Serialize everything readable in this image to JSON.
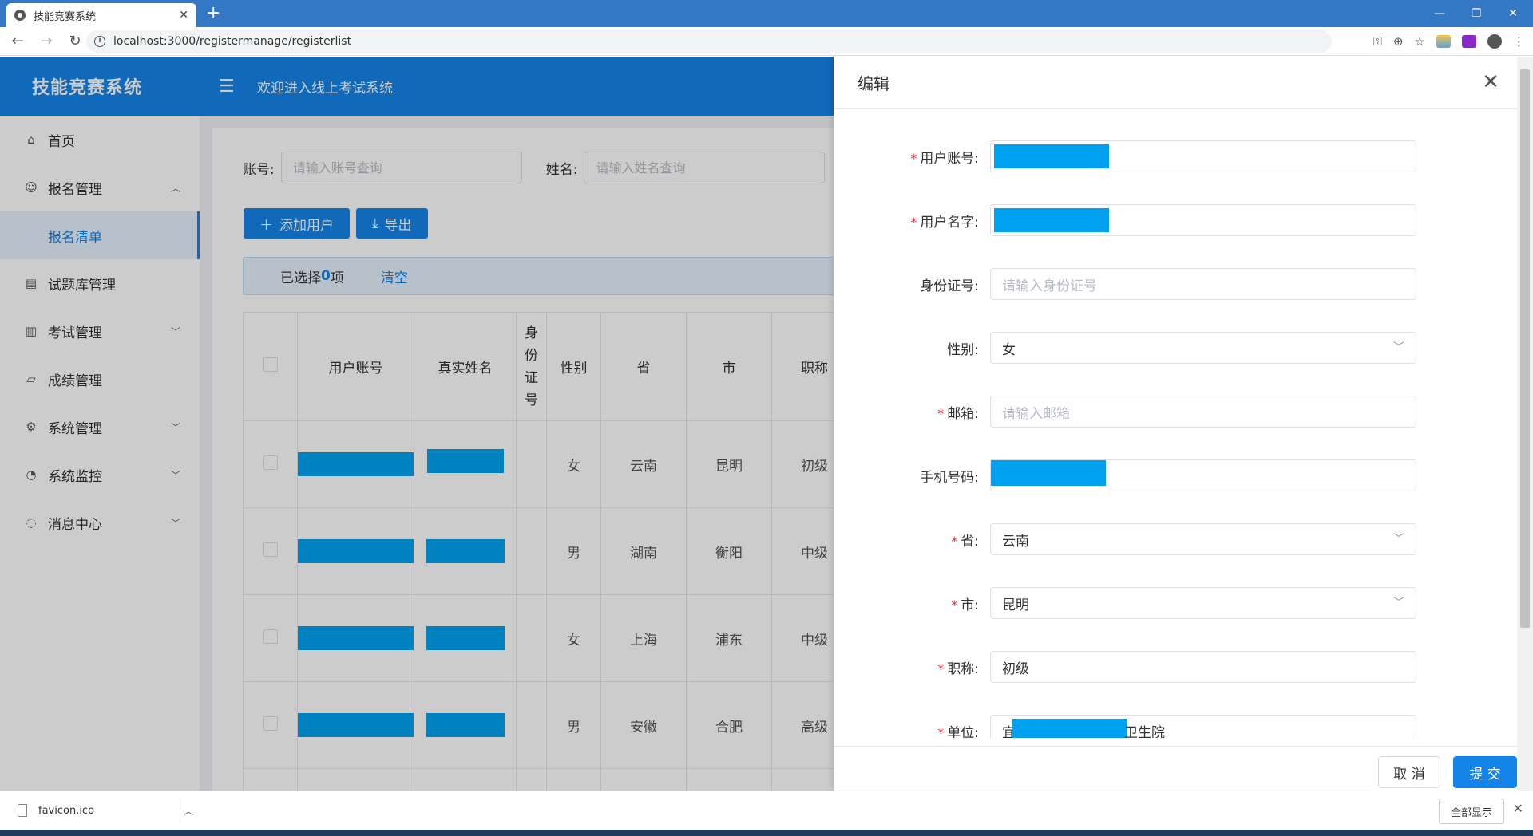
{
  "browser": {
    "tab_title": "技能竞赛系统",
    "url": "localhost:3000/registermanage/registerlist"
  },
  "app": {
    "brand": "技能竞赛系统",
    "welcome": "欢迎进入线上考试系统"
  },
  "sidebar": {
    "items": [
      {
        "label": "首页",
        "icon": "home-icon"
      },
      {
        "label": "报名管理",
        "icon": "user-icon",
        "expanded": true
      },
      {
        "label": "报名清单",
        "active": true
      },
      {
        "label": "试题库管理",
        "icon": "document-icon"
      },
      {
        "label": "考试管理",
        "icon": "book-icon"
      },
      {
        "label": "成绩管理",
        "icon": "chart-icon"
      },
      {
        "label": "系统管理",
        "icon": "gear-icon"
      },
      {
        "label": "系统监控",
        "icon": "dashboard-icon"
      },
      {
        "label": "消息中心",
        "icon": "message-icon"
      }
    ]
  },
  "search": {
    "account_label": "账号:",
    "account_placeholder": "请输入账号查询",
    "name_label": "姓名:",
    "name_placeholder": "请输入姓名查询"
  },
  "toolbar": {
    "add_label": "添加用户",
    "export_label": "导出"
  },
  "selection": {
    "prefix": "已选择",
    "count": "0",
    "suffix": "项",
    "clear_label": "清空"
  },
  "table": {
    "headers": [
      "用户账号",
      "真实姓名",
      "身份证号",
      "性别",
      "省",
      "市",
      "职称"
    ],
    "rows": [
      {
        "gender": "女",
        "province": "云南",
        "city": "昆明",
        "title": "初级"
      },
      {
        "gender": "男",
        "province": "湖南",
        "city": "衡阳",
        "title": "中级"
      },
      {
        "gender": "女",
        "province": "上海",
        "city": "浦东",
        "title": "中级"
      },
      {
        "gender": "男",
        "province": "安徽",
        "city": "合肥",
        "title": "高级"
      }
    ]
  },
  "drawer": {
    "title": "编辑",
    "fields": {
      "account": {
        "label": "用户账号:",
        "required": true
      },
      "username": {
        "label": "用户名字:",
        "required": true
      },
      "idcard": {
        "label": "身份证号:",
        "placeholder": "请输入身份证号"
      },
      "gender": {
        "label": "性别:",
        "value": "女"
      },
      "email": {
        "label": "邮箱:",
        "required": true,
        "placeholder": "请输入邮箱"
      },
      "phone": {
        "label": "手机号码:"
      },
      "province": {
        "label": "省:",
        "required": true,
        "value": "云南"
      },
      "city": {
        "label": "市:",
        "required": true,
        "value": "昆明"
      },
      "title": {
        "label": "职称:",
        "required": true,
        "value": "初级"
      },
      "unit": {
        "label": "单位:",
        "required": true,
        "value_start": "宜",
        "value_end": "卫生院"
      }
    },
    "cancel_label": "取 消",
    "submit_label": "提 交"
  },
  "downloads": {
    "file": "favicon.ico",
    "show_all": "全部显示"
  },
  "colors": {
    "primary": "#1584e8",
    "redaction": "#00a2f0",
    "required": "#f5222d"
  }
}
